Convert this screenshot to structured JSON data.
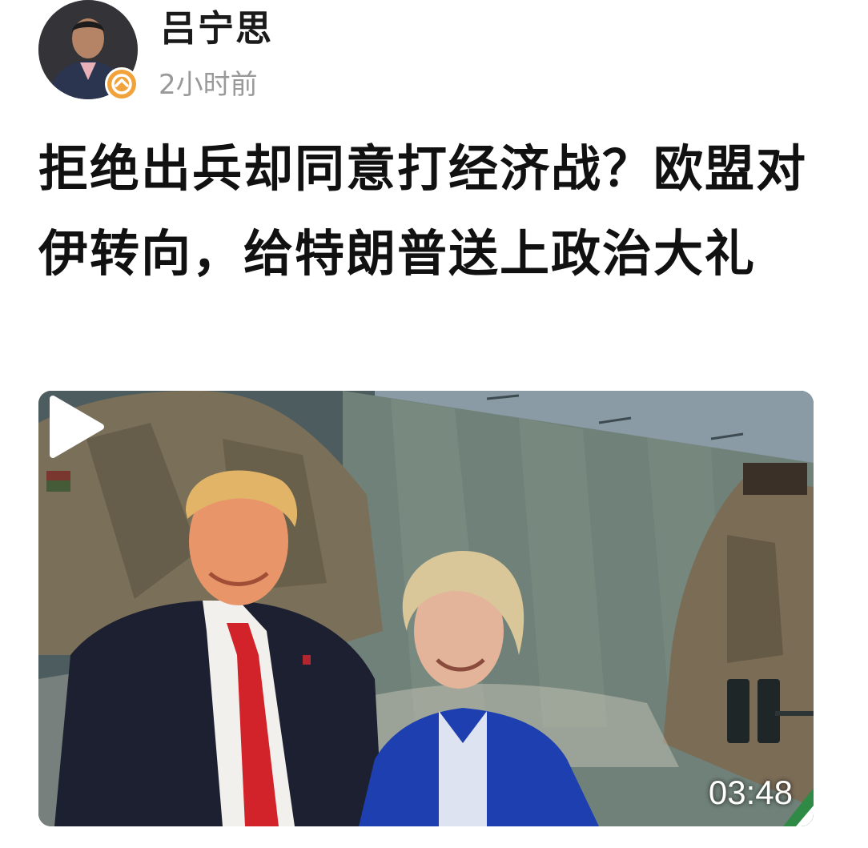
{
  "post": {
    "author_name": "吕宁思",
    "time_ago": "2小时前",
    "title": "拒绝出兵却同意打经济战？欧盟对伊转向，给特朗普送上政治大礼"
  },
  "video": {
    "duration": "03:48",
    "icon": "play-icon"
  },
  "colors": {
    "badge": "#f2a23a",
    "time_text": "#999999",
    "title_text": "#111111"
  }
}
